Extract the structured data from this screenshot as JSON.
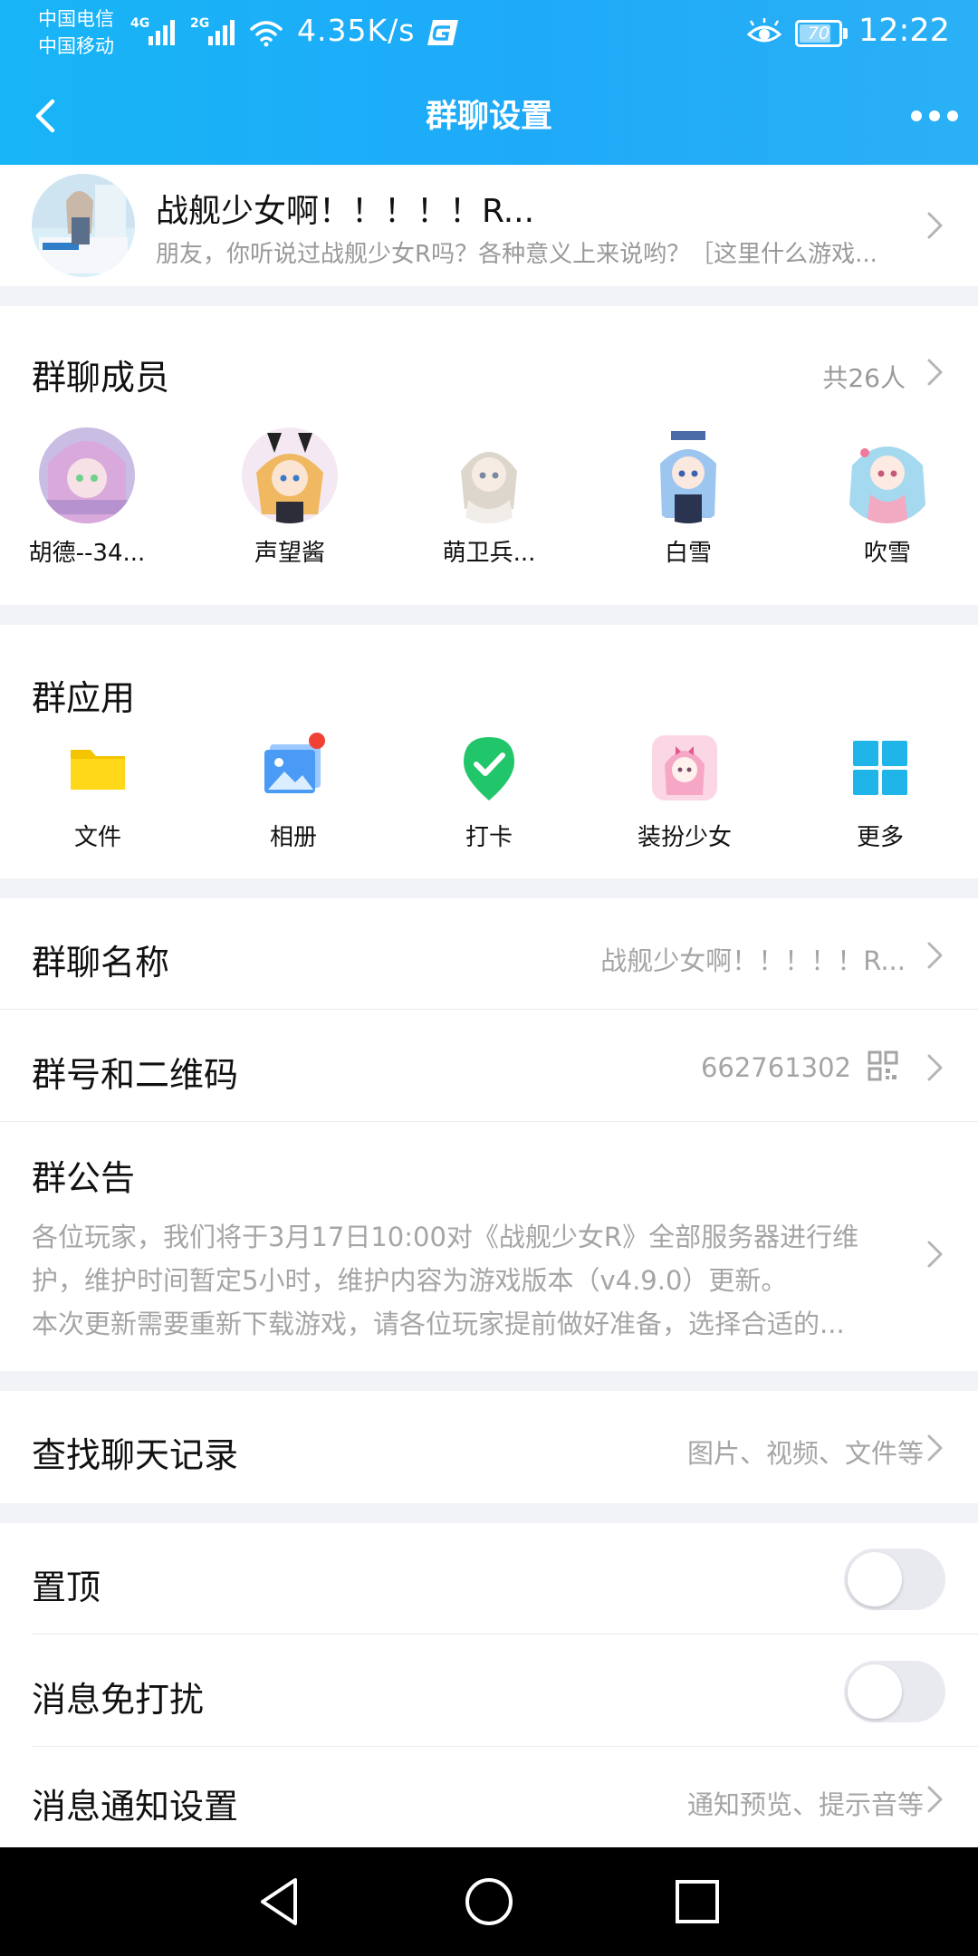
{
  "status_bar": {
    "carrier1": "中国电信",
    "carrier2": "中国移动",
    "signal1_tag": "4G",
    "signal2_tag": "2G",
    "speed": "4.35K/s",
    "battery": "70",
    "time": "12:22"
  },
  "header": {
    "title": "群聊设置"
  },
  "group": {
    "name": "战舰少女啊！！！！！R...",
    "description": "朋友，你听说过战舰少女R吗？各种意义上来说哟？［这里什么游戏..."
  },
  "members": {
    "title": "群聊成员",
    "count": "共26人",
    "items": [
      {
        "name": "胡德--34...",
        "avatar_color": "#b9a7d9"
      },
      {
        "name": "声望酱",
        "avatar_color": "#f3c78a"
      },
      {
        "name": "萌卫兵...",
        "avatar_color": "#e9e4dc"
      },
      {
        "name": "白雪",
        "avatar_color": "#8fb5e6"
      },
      {
        "name": "吹雪",
        "avatar_color": "#a9d7ee"
      }
    ]
  },
  "apps": {
    "title": "群应用",
    "items": [
      {
        "label": "文件",
        "icon": "folder-icon"
      },
      {
        "label": "相册",
        "icon": "album-icon"
      },
      {
        "label": "打卡",
        "icon": "checkin-icon"
      },
      {
        "label": "装扮少女",
        "icon": "dressup-girl-icon"
      },
      {
        "label": "更多",
        "icon": "grid-icon"
      }
    ]
  },
  "info": {
    "name_label": "群聊名称",
    "name_value": "战舰少女啊！！！！！R...",
    "number_label": "群号和二维码",
    "number_value": "662761302",
    "notice_label": "群公告",
    "notice_lines": [
      "各位玩家，我们将于3月17日10:00对《战舰少女R》全部服务器进行维",
      "护，维护时间暂定5小时，维护内容为游戏版本（v4.9.0）更新。",
      "本次更新需要重新下载游戏，请各位玩家提前做好准备，选择合适的..."
    ]
  },
  "search": {
    "label": "查找聊天记录",
    "value": "图片、视频、文件等"
  },
  "settings": {
    "pin_label": "置顶",
    "pin_on": false,
    "mute_label": "消息免打扰",
    "mute_on": false,
    "notify_label": "消息通知设置",
    "notify_value": "通知预览、提示音等"
  },
  "colors": {
    "header_start": "#17b5f7",
    "header_end": "#2ab0f5",
    "secondary_text": "#a5a5a5",
    "badge_red": "#f04134"
  }
}
